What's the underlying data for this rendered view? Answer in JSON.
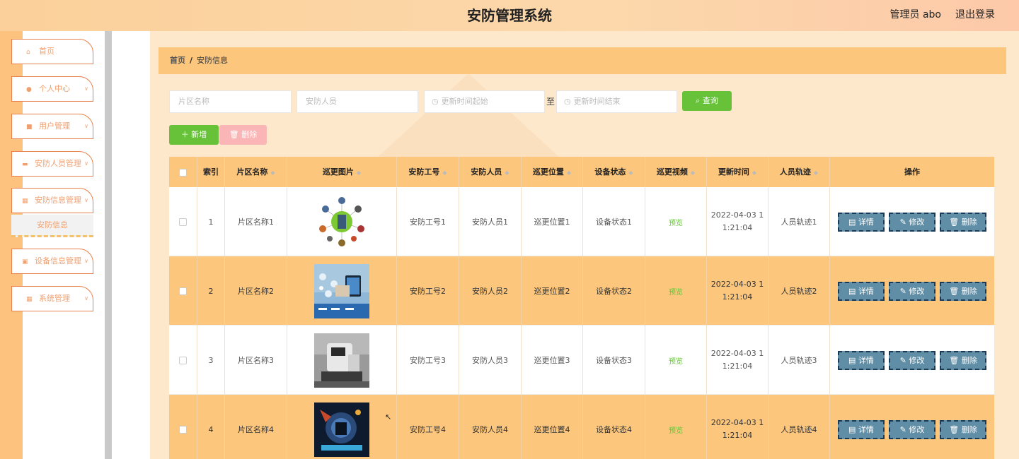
{
  "header": {
    "title": "安防管理系统",
    "admin": "管理员 abo",
    "logout": "退出登录"
  },
  "sidebar": {
    "items": [
      {
        "label": "首页",
        "icon": "home-icon",
        "chevron": false
      },
      {
        "label": "个人中心",
        "icon": "user-icon",
        "chevron": true
      },
      {
        "label": "用户管理",
        "icon": "chat-icon",
        "chevron": true
      },
      {
        "label": "安防人员管理",
        "icon": "briefcase-icon",
        "chevron": true
      },
      {
        "label": "安防信息管理",
        "icon": "grid-icon",
        "chevron": true
      },
      {
        "label": "设备信息管理",
        "icon": "clipboard-icon",
        "chevron": true
      },
      {
        "label": "系统管理",
        "icon": "grid-icon",
        "chevron": true
      }
    ],
    "submenu": "安防信息"
  },
  "breadcrumb": {
    "home": "首页",
    "sep": "/",
    "current": "安防信息"
  },
  "search": {
    "area_placeholder": "片区名称",
    "person_placeholder": "安防人员",
    "start_placeholder": "更新时间起始",
    "end_placeholder": "更新时间结束",
    "to": "至",
    "search_label": "查询"
  },
  "actions": {
    "add_label": "新增",
    "delete_label": "删除"
  },
  "table": {
    "columns": [
      "索引",
      "片区名称",
      "巡更图片",
      "安防工号",
      "安防人员",
      "巡更位置",
      "设备状态",
      "巡更视频",
      "更新时间",
      "人员轨迹",
      "操作"
    ],
    "rows": [
      {
        "index": "1",
        "area": "片区名称1",
        "job_no": "安防工号1",
        "person": "安防人员1",
        "position": "巡更位置1",
        "status": "设备状态1",
        "video": "预览",
        "time_1": "2022-04-03 1",
        "time_2": "1:21:04",
        "track": "人员轨迹1"
      },
      {
        "index": "2",
        "area": "片区名称2",
        "job_no": "安防工号2",
        "person": "安防人员2",
        "position": "巡更位置2",
        "status": "设备状态2",
        "video": "预览",
        "time_1": "2022-04-03 1",
        "time_2": "1:21:04",
        "track": "人员轨迹2"
      },
      {
        "index": "3",
        "area": "片区名称3",
        "job_no": "安防工号3",
        "person": "安防人员3",
        "position": "巡更位置3",
        "status": "设备状态3",
        "video": "预览",
        "time_1": "2022-04-03 1",
        "time_2": "1:21:04",
        "track": "人员轨迹3"
      },
      {
        "index": "4",
        "area": "片区名称4",
        "job_no": "安防工号4",
        "person": "安防人员4",
        "position": "巡更位置4",
        "status": "设备状态4",
        "video": "预览",
        "time_1": "2022-04-03 1",
        "time_2": "1:21:04",
        "track": "人员轨迹4"
      }
    ],
    "op_labels": {
      "detail": "详情",
      "edit": "修改",
      "delete": "删除"
    }
  },
  "colors": {
    "accent": "#fcc67c",
    "success": "#67c23a",
    "danger_light": "#fab6b6",
    "op_button": "#5f8ea6"
  }
}
